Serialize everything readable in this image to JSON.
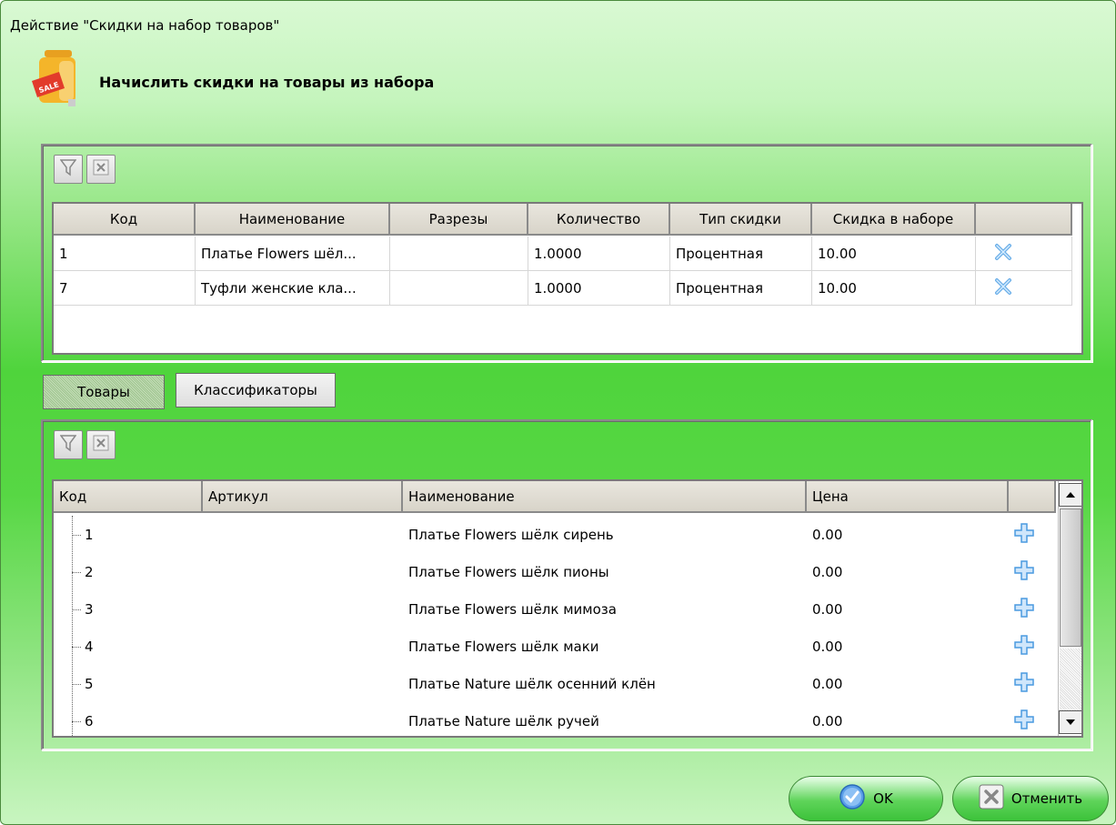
{
  "window": {
    "title": "Действие \"Скидки на набор товаров\""
  },
  "header": {
    "title": "Начислить скидки на товары из набора",
    "icon": "sale-bag-icon"
  },
  "set_grid": {
    "columns": [
      "Код",
      "Наименование",
      "Разрезы",
      "Количество",
      "Тип скидки",
      "Скидка в наборе",
      ""
    ],
    "rows": [
      {
        "code": "1",
        "name": "Платье Flowers шёл...",
        "cuts": "",
        "qty": "1.0000",
        "type": "Процентная",
        "discount": "10.00"
      },
      {
        "code": "7",
        "name": "Туфли женские кла...",
        "cuts": "",
        "qty": "1.0000",
        "type": "Процентная",
        "discount": "10.00"
      }
    ]
  },
  "tabs": {
    "goods": "Товары",
    "classifiers": "Классификаторы"
  },
  "goods_grid": {
    "columns": [
      "Код",
      "Артикул",
      "Наименование",
      "Цена",
      ""
    ],
    "rows": [
      {
        "code": "1",
        "article": "",
        "name": "Платье Flowers шёлк сирень",
        "price": "0.00"
      },
      {
        "code": "2",
        "article": "",
        "name": "Платье Flowers шёлк пионы",
        "price": "0.00"
      },
      {
        "code": "3",
        "article": "",
        "name": "Платье Flowers шёлк мимоза",
        "price": "0.00"
      },
      {
        "code": "4",
        "article": "",
        "name": "Платье Flowers шёлк маки",
        "price": "0.00"
      },
      {
        "code": "5",
        "article": "",
        "name": "Платье Nature шёлк осенний клён",
        "price": "0.00"
      },
      {
        "code": "6",
        "article": "",
        "name": "Платье Nature шёлк ручей",
        "price": "0.00"
      }
    ]
  },
  "buttons": {
    "ok": "OK",
    "cancel": "Отменить"
  },
  "colors": {
    "accent_green": "#4fd43c",
    "remove_blue": "#5aa0e0",
    "add_blue": "#4a9ae0"
  }
}
